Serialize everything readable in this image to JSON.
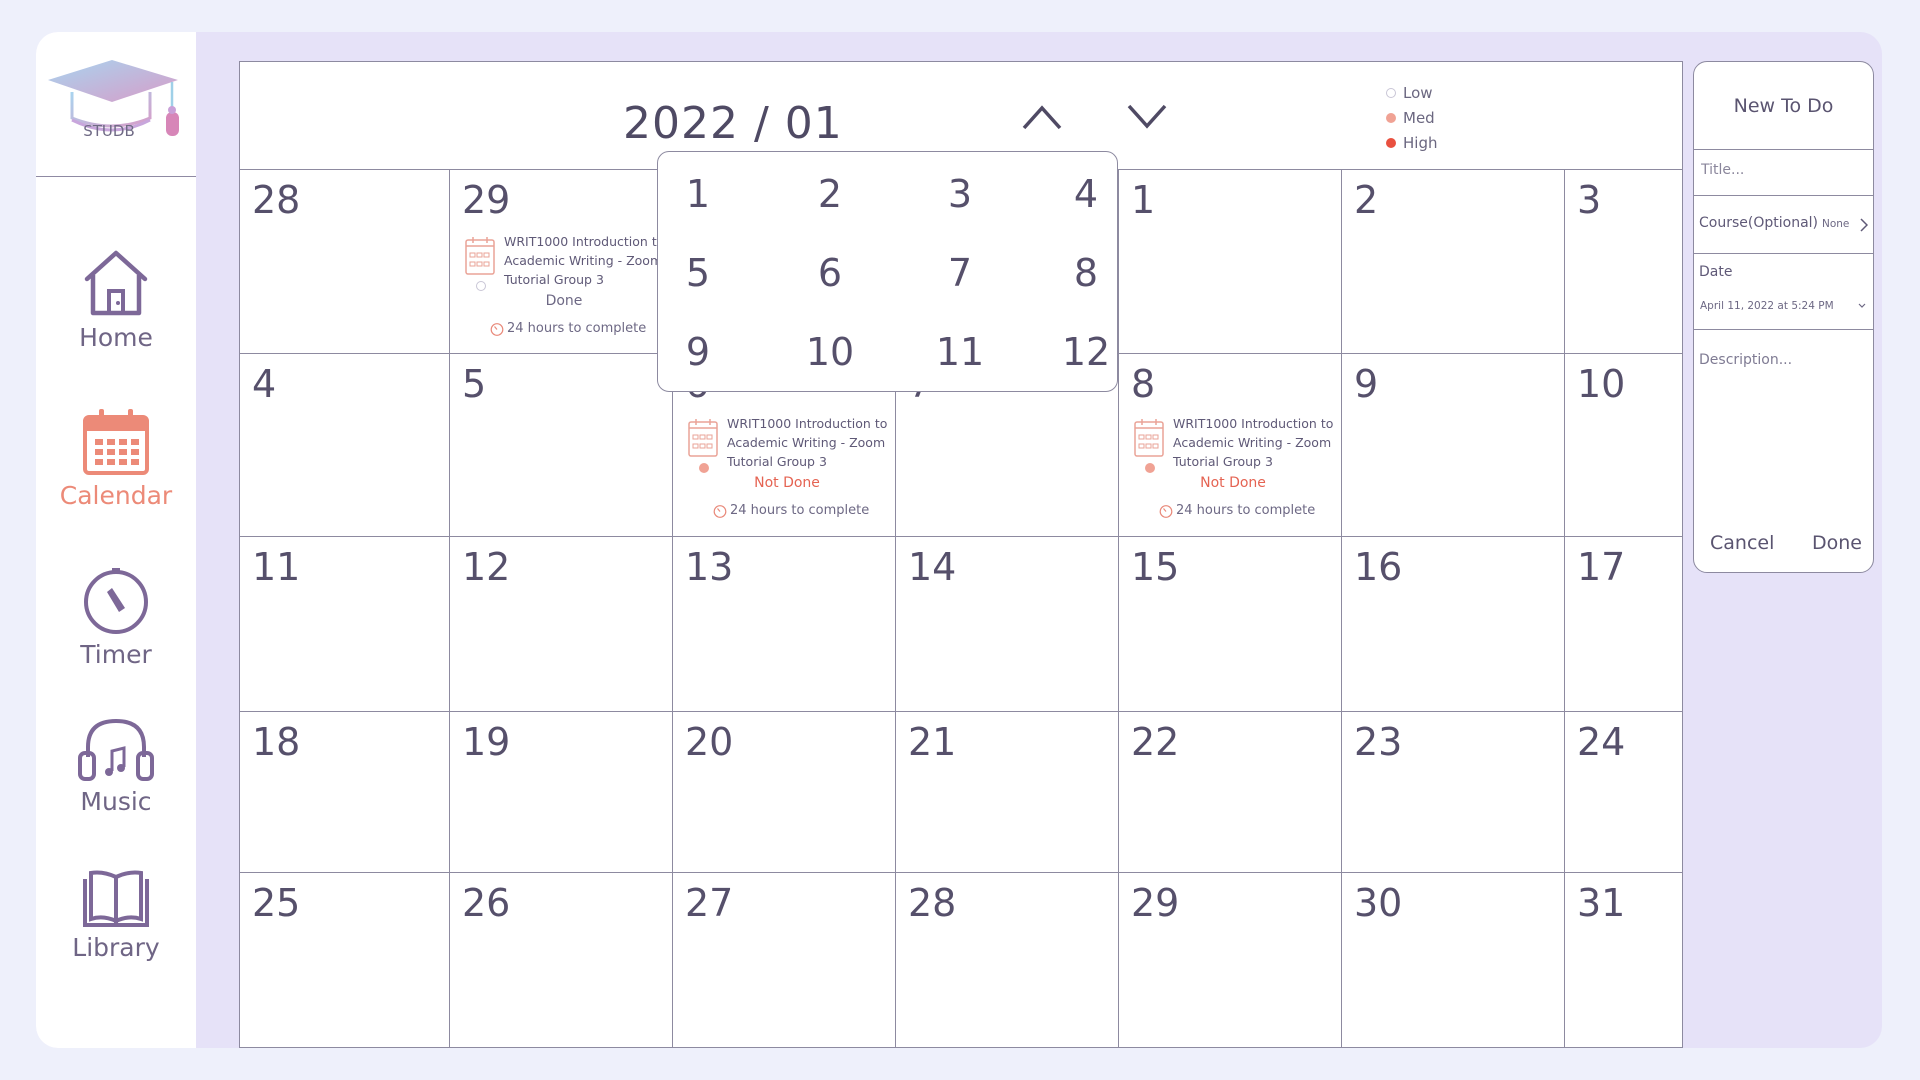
{
  "app": {
    "logo_text": "STUDB"
  },
  "nav": [
    {
      "label": "Home"
    },
    {
      "label": "Calendar"
    },
    {
      "label": "Timer"
    },
    {
      "label": "Music"
    },
    {
      "label": "Library"
    }
  ],
  "calendar": {
    "month_title": "2022 / 01",
    "legend": [
      {
        "label": "Low",
        "color": "#ffffff"
      },
      {
        "label": "Med",
        "color": "#f0a294"
      },
      {
        "label": "High",
        "color": "#e9503f"
      }
    ],
    "weeks": [
      [
        "28",
        "29",
        "",
        "",
        "1",
        "2",
        "3"
      ],
      [
        "4",
        "5",
        "6",
        "7",
        "8",
        "9",
        "10"
      ],
      [
        "11",
        "12",
        "13",
        "14",
        "15",
        "16",
        "17"
      ],
      [
        "18",
        "19",
        "20",
        "21",
        "22",
        "23",
        "24"
      ],
      [
        "25",
        "26",
        "27",
        "28",
        "29",
        "30",
        "31"
      ]
    ],
    "events": [
      {
        "title": "WRIT1000 Introduction to Academic Writing - Zoom Tutorial Group 3",
        "status": "Done",
        "time": "24 hours to complete",
        "priority": "Low"
      },
      {
        "title": "WRIT1000 Introduction to Academic Writing - Zoom Tutorial Group 3",
        "status": "Not Done",
        "time": "24 hours to complete",
        "priority": "Med"
      },
      {
        "title": "WRIT1000 Introduction to Academic Writing - Zoom Tutorial Group 3",
        "status": "Not Done",
        "time": "24 hours to complete",
        "priority": "Med"
      }
    ]
  },
  "month_picker": {
    "months": [
      "1",
      "2",
      "3",
      "4",
      "5",
      "6",
      "7",
      "8",
      "9",
      "10",
      "11",
      "12"
    ]
  },
  "new_todo": {
    "heading": "New To Do",
    "title_placeholder": "Title...",
    "course_label": "Course(Optional)",
    "course_value": "None",
    "date_label": "Date",
    "date_value": "April 11, 2022 at 5:24 PM",
    "description_placeholder": "Description...",
    "cancel_label": "Cancel",
    "done_label": "Done"
  }
}
